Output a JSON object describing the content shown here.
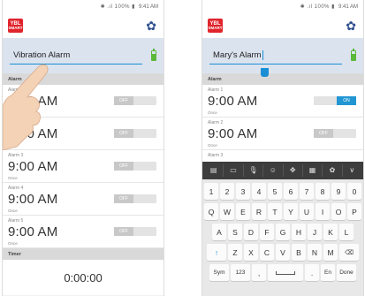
{
  "status_bar": {
    "icons": "✱ .ıl 100% ▮",
    "time": "9:41 AM"
  },
  "app": {
    "logo_line1": "YBL",
    "logo_line2": "SMART",
    "settings_icon": "gear-icon"
  },
  "left_screen": {
    "name_value": "Vibration Alarm",
    "alarm_section": "Alarm",
    "alarms": [
      {
        "label": "Alarm 1",
        "time": "9:00 AM",
        "repeat": "Once",
        "toggle": "OFF"
      },
      {
        "label": "Alarm 2",
        "time": "9:00 AM",
        "repeat": "Once",
        "toggle": "OFF"
      },
      {
        "label": "Alarm 3",
        "time": "9:00 AM",
        "repeat": "Once",
        "toggle": "OFF"
      },
      {
        "label": "Alarm 4",
        "time": "9:00 AM",
        "repeat": "Once",
        "toggle": "OFF"
      },
      {
        "label": "Alarm 5",
        "time": "9:00 AM",
        "repeat": "Once",
        "toggle": "OFF"
      }
    ],
    "timer_section": "Timer",
    "timer_value": "0:00:00"
  },
  "right_screen": {
    "name_value": "Mary's Alarm",
    "alarm_section": "Alarm",
    "alarms": [
      {
        "label": "Alarm 1",
        "time": "9:00 AM",
        "repeat": "Once",
        "toggle": "ON"
      },
      {
        "label": "Alarm 2",
        "time": "9:00 AM",
        "repeat": "Once",
        "toggle": "OFF"
      },
      {
        "label": "Alarm 3",
        "time": "",
        "repeat": "",
        "toggle": ""
      }
    ]
  },
  "keyboard": {
    "toolbar": [
      "▤",
      "▭",
      "🎙",
      "☺",
      "✥",
      "▦",
      "✿",
      "∨"
    ],
    "row1": [
      "1",
      "2",
      "3",
      "4",
      "5",
      "6",
      "7",
      "8",
      "9",
      "0"
    ],
    "row2": [
      "Q",
      "W",
      "E",
      "R",
      "T",
      "Y",
      "U",
      "I",
      "O",
      "P"
    ],
    "row3": [
      "A",
      "S",
      "D",
      "F",
      "G",
      "H",
      "J",
      "K",
      "L"
    ],
    "row4": [
      "↑",
      "Z",
      "X",
      "C",
      "V",
      "B",
      "N",
      "M",
      "⌫"
    ],
    "row5": {
      "sym": "Sym",
      "num": "123",
      "comma": ",",
      "period": ".",
      "lang": "En",
      "done": "Done"
    }
  }
}
